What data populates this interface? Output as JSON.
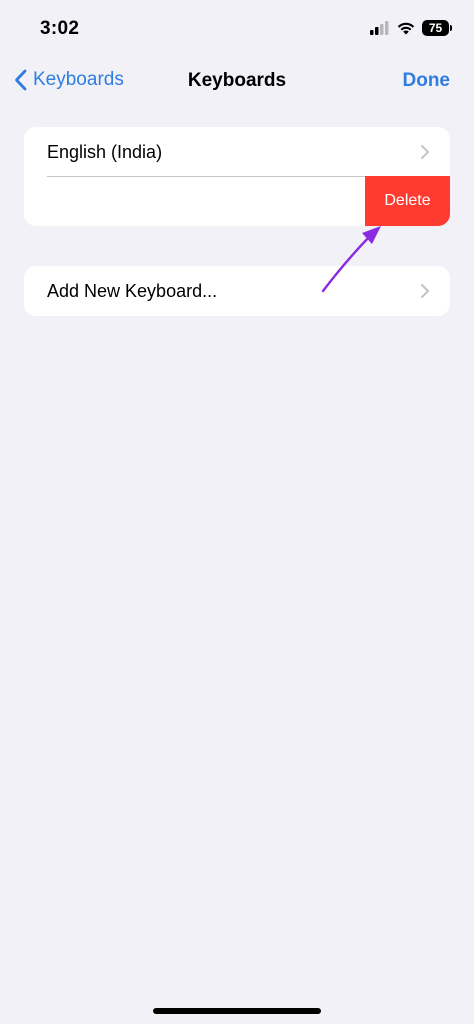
{
  "status_bar": {
    "time": "3:02",
    "battery": "75",
    "icons": [
      "cellular-signal-icon",
      "wifi-icon",
      "battery-icon"
    ]
  },
  "nav": {
    "back_label": "Keyboards",
    "title": "Keyboards",
    "done_label": "Done"
  },
  "keyboards_group": {
    "items": [
      {
        "label": "English (India)",
        "icon": "chevron-right-icon"
      }
    ],
    "swipe_action": {
      "label": "Delete",
      "color": "#ff3b30"
    }
  },
  "add_group": {
    "label": "Add New Keyboard...",
    "icon": "chevron-right-icon"
  },
  "annotation": {
    "icon": "arrow-annotation-icon",
    "color": "#8a2be2"
  },
  "colors": {
    "accent": "#2f7de1",
    "background": "#f2f1f7",
    "destructive": "#ff3b30"
  }
}
